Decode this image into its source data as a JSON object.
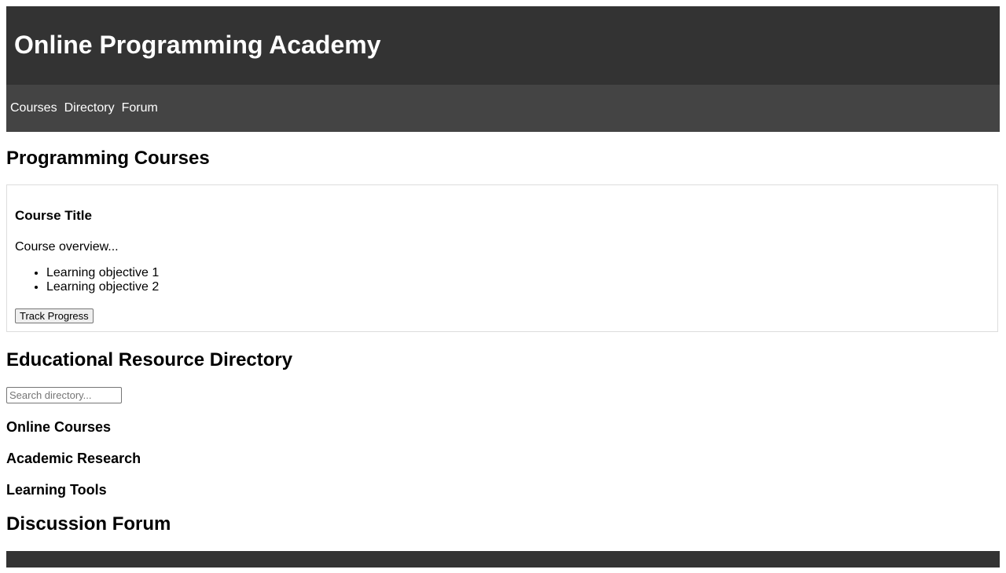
{
  "header": {
    "title": "Online Programming Academy"
  },
  "nav": {
    "items": [
      "Courses",
      "Directory",
      "Forum"
    ]
  },
  "courses": {
    "heading": "Programming Courses",
    "card": {
      "title": "Course Title",
      "overview": "Course overview...",
      "objectives": [
        "Learning objective 1",
        "Learning objective 2"
      ],
      "button_label": "Track Progress"
    }
  },
  "directory": {
    "heading": "Educational Resource Directory",
    "search_placeholder": "Search directory...",
    "categories": [
      "Online Courses",
      "Academic Research",
      "Learning Tools"
    ]
  },
  "forum": {
    "heading": "Discussion Forum"
  },
  "colors": {
    "header_bg": "#333333",
    "nav_bg": "#444444",
    "footer_bg": "#333333",
    "card_border": "#dddddd"
  }
}
